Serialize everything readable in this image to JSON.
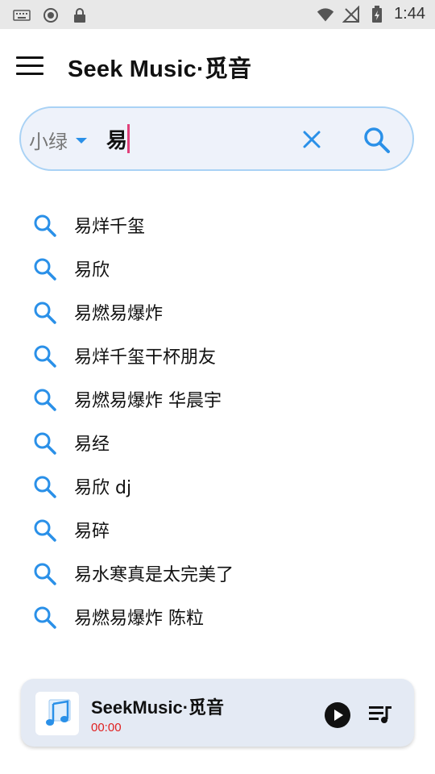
{
  "status_bar": {
    "time": "1:44",
    "left_icons": [
      "keyboard-icon",
      "record-icon",
      "lock-icon"
    ],
    "right_icons": [
      "wifi-icon",
      "no-signal-icon",
      "battery-icon"
    ]
  },
  "app_bar": {
    "title": "Seek Music·觅音",
    "menu_icon": "hamburger-menu-icon"
  },
  "search": {
    "source": "小绿",
    "query": "易",
    "clear_icon": "close-icon",
    "submit_icon": "search-icon"
  },
  "suggestions": [
    "易烊千玺",
    "易欣",
    "易燃易爆炸",
    "易烊千玺干杯朋友",
    "易燃易爆炸 华晨宇",
    "易经",
    "易欣 dj",
    "易碎",
    "易水寒真是太完美了",
    "易燃易爆炸 陈粒"
  ],
  "player": {
    "title": "SeekMusic·觅音",
    "time": "00:00",
    "play_icon": "play-icon",
    "queue_icon": "playlist-icon"
  },
  "colors": {
    "accent": "#2a90e8",
    "search_bg": "#eef2fa",
    "search_border": "#a9d2f5",
    "player_bg": "#e4eaf4",
    "time_red": "#e02020",
    "cursor_pink": "#e0407a"
  }
}
